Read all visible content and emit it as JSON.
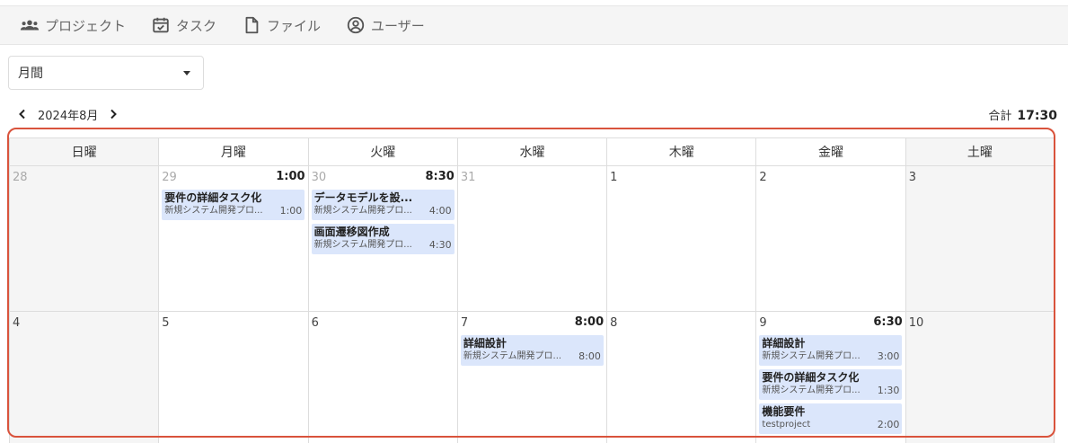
{
  "nav": {
    "projects": "プロジェクト",
    "tasks": "タスク",
    "files": "ファイル",
    "users": "ユーザー"
  },
  "view_select": {
    "value": "月間"
  },
  "month_nav": {
    "label": "2024年8月"
  },
  "total": {
    "label": "合計",
    "value": "17:30"
  },
  "weekdays": [
    "日曜",
    "月曜",
    "火曜",
    "水曜",
    "木曜",
    "金曜",
    "土曜"
  ],
  "weeks": [
    [
      {
        "day": "28",
        "total": "",
        "events": []
      },
      {
        "day": "29",
        "total": "1:00",
        "events": [
          {
            "title": "要件の詳細タスク化",
            "project": "新規システム開発プロ...",
            "time": "1:00"
          }
        ]
      },
      {
        "day": "30",
        "total": "8:30",
        "events": [
          {
            "title": "データモデルを設...",
            "project": "新規システム開発プロ...",
            "time": "4:00"
          },
          {
            "title": "画面遷移図作成",
            "project": "新規システム開発プロ...",
            "time": "4:30"
          }
        ]
      },
      {
        "day": "31",
        "total": "",
        "events": []
      },
      {
        "day": "1",
        "total": "",
        "events": []
      },
      {
        "day": "2",
        "total": "",
        "events": []
      },
      {
        "day": "3",
        "total": "",
        "events": []
      }
    ],
    [
      {
        "day": "4",
        "total": "",
        "events": []
      },
      {
        "day": "5",
        "total": "",
        "events": []
      },
      {
        "day": "6",
        "total": "",
        "events": []
      },
      {
        "day": "7",
        "total": "8:00",
        "events": [
          {
            "title": "詳細設計",
            "project": "新規システム開発プロ...",
            "time": "8:00"
          }
        ]
      },
      {
        "day": "8",
        "total": "",
        "events": []
      },
      {
        "day": "9",
        "total": "6:30",
        "events": [
          {
            "title": "詳細設計",
            "project": "新規システム開発プロ...",
            "time": "3:00"
          },
          {
            "title": "要件の詳細タスク化",
            "project": "新規システム開発プロ...",
            "time": "1:30"
          },
          {
            "title": "機能要件",
            "project": "testproject",
            "time": "2:00"
          }
        ]
      },
      {
        "day": "10",
        "total": "",
        "events": []
      }
    ]
  ]
}
